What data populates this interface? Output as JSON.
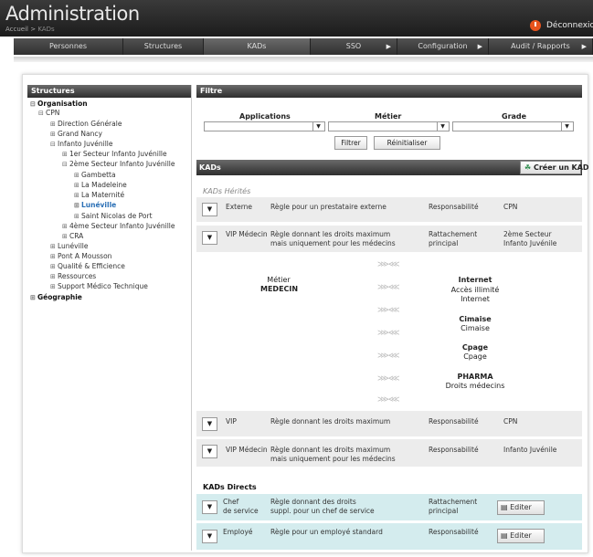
{
  "header": {
    "title": "Administration",
    "breadcrumb_home": "Accueil",
    "breadcrumb_sep": " > ",
    "breadcrumb_current": "KADs",
    "logout": "Déconnexion"
  },
  "nav": [
    {
      "label": "Personnes",
      "arrow": ""
    },
    {
      "label": "Structures",
      "arrow": ""
    },
    {
      "label": "KADs",
      "arrow": ""
    },
    {
      "label": "SSO",
      "arrow": "▶"
    },
    {
      "label": "Configuration",
      "arrow": "▶"
    },
    {
      "label": "Audit / Rapports",
      "arrow": "▶"
    }
  ],
  "sidebar": {
    "title": "Structures",
    "tree": [
      {
        "label": "Organisation",
        "toggle": "⊟"
      },
      {
        "label": "CPN",
        "toggle": "⊟"
      },
      {
        "label": "Direction Générale",
        "toggle": "⊞"
      },
      {
        "label": "Grand Nancy",
        "toggle": "⊞"
      },
      {
        "label": "Infanto Juvénille",
        "toggle": "⊟"
      },
      {
        "label": "1er Secteur Infanto Juvénille",
        "toggle": "⊞"
      },
      {
        "label": "2ème Secteur Infanto Juvénille",
        "toggle": "⊟"
      },
      {
        "label": "Gambetta",
        "toggle": "⊞"
      },
      {
        "label": "La Madeleine",
        "toggle": "⊞"
      },
      {
        "label": "La Maternité",
        "toggle": "⊞"
      },
      {
        "label": "Lunéville",
        "toggle": "⊞"
      },
      {
        "label": "Saint Nicolas de Port",
        "toggle": "⊞"
      },
      {
        "label": "4ème Secteur Infanto Juvénille",
        "toggle": "⊞"
      },
      {
        "label": "CRA",
        "toggle": "⊞"
      },
      {
        "label": "Lunéville",
        "toggle": "⊞"
      },
      {
        "label": "Pont A Mousson",
        "toggle": "⊞"
      },
      {
        "label": "Qualité & Efficience",
        "toggle": "⊞"
      },
      {
        "label": "Ressources",
        "toggle": "⊞"
      },
      {
        "label": "Support Médico Technique",
        "toggle": "⊞"
      },
      {
        "label": "Géographie",
        "toggle": "⊞"
      }
    ]
  },
  "filter": {
    "title": "Filtre",
    "applications": "Applications",
    "metier": "Métier",
    "grade": "Grade",
    "filter_btn": "Filtrer",
    "reset_btn": "Réinitialiser",
    "dropdown": "▼"
  },
  "kads": {
    "title": "KADs",
    "create": "Créer un KAD",
    "inherited_title": "KADs Hérités",
    "direct_title": "KADs Directs",
    "edit": "Editer",
    "expand": "▼",
    "inherited": [
      {
        "name": "Externe",
        "desc": [
          "Règle pour un prestataire externe"
        ],
        "type": [
          "Responsabilité"
        ],
        "scope": [
          "CPN"
        ]
      },
      {
        "name": "VIP Médecin",
        "desc": [
          "Règle donnant les droits maximum",
          "mais uniquement pour les médecins"
        ],
        "type": [
          "Rattachement",
          "principal"
        ],
        "scope": [
          "2ème Secteur",
          "Infanto Juvénile"
        ]
      },
      {
        "name": "VIP",
        "desc": [
          "Règle donnant les droits maximum"
        ],
        "type": [
          "Responsabilité"
        ],
        "scope": [
          "CPN"
        ]
      },
      {
        "name": "VIP Médecin",
        "desc": [
          "Règle donnant les droits maximum",
          "mais uniquement pour les médecins"
        ],
        "type": [
          "Responsabilité"
        ],
        "scope": [
          "Infanto Juvénile"
        ]
      }
    ],
    "detail": {
      "metier_label": "Métier",
      "metier_value": "MEDECIN",
      "arrow": "⋙⋘",
      "apps": [
        {
          "name": "Internet",
          "lines": [
            "Accès illimité",
            "Internet"
          ]
        },
        {
          "name": "Cimaise",
          "lines": [
            "Cimaise"
          ]
        },
        {
          "name": "Cpage",
          "lines": [
            "Cpage"
          ]
        },
        {
          "name": "PHARMA",
          "lines": [
            "Droits médecins"
          ]
        }
      ]
    },
    "direct": [
      {
        "name": [
          "Chef",
          "de service"
        ],
        "desc": [
          "Règle donnant des droits",
          "suppl. pour un chef de service"
        ],
        "type": [
          "Rattachement",
          "principal"
        ]
      },
      {
        "name": [
          "Employé"
        ],
        "desc": [
          "Règle pour un employé standard"
        ],
        "type": [
          "Responsabilité"
        ]
      }
    ]
  }
}
